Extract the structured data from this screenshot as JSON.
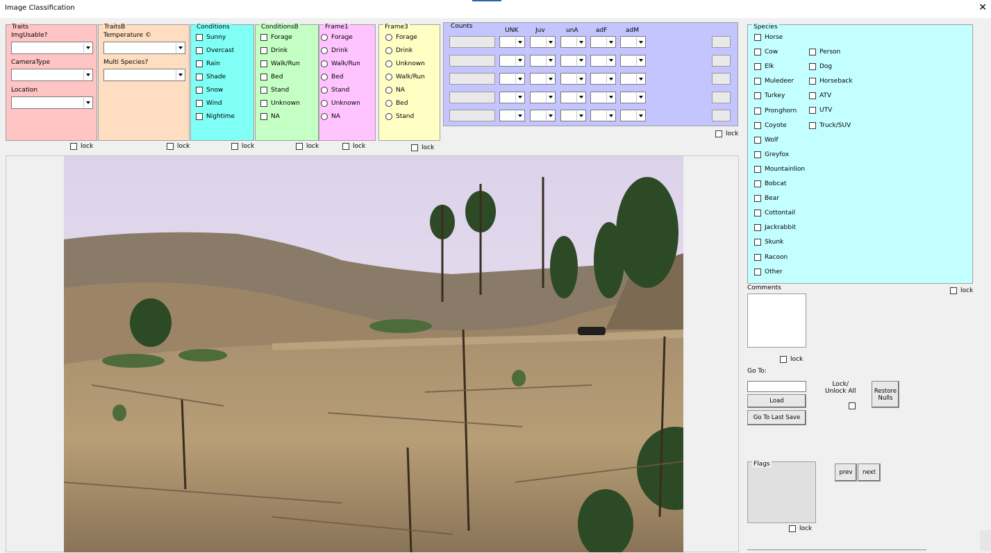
{
  "window": {
    "title": "Image Classification",
    "close_glyph": "✕"
  },
  "lock_label": "lock",
  "traits": {
    "legend": "Traits",
    "img_usable": "ImgUsable?",
    "camera_type": "CameraType",
    "location": "Location"
  },
  "traitsb": {
    "legend": "TraitsB",
    "temperature": "Temperature ©",
    "multi_species": "Multi Species?"
  },
  "conditions": {
    "legend": "Conditions",
    "items": [
      "Sunny",
      "Overcast",
      "Rain",
      "Shade",
      "Snow",
      "Wind",
      "Nightime"
    ]
  },
  "conditionsb": {
    "legend": "ConditionsB",
    "items": [
      "Forage",
      "Drink",
      "Walk/Run",
      "Bed",
      "Stand",
      "Unknown",
      "NA"
    ]
  },
  "frame1": {
    "legend": "Frame1",
    "items": [
      "Forage",
      "Drink",
      "Walk/Run",
      "Bed",
      "Stand",
      "Unknown",
      "NA"
    ]
  },
  "frame3": {
    "legend": "Frame3",
    "items": [
      "Forage",
      "Drink",
      "Unknown",
      "Walk/Run",
      "NA",
      "Bed",
      "Stand"
    ]
  },
  "counts": {
    "legend": "Counts",
    "columns": [
      "UNK",
      "Juv",
      "unA",
      "adF",
      "adM"
    ]
  },
  "species": {
    "legend": "Species",
    "col1": [
      "Horse",
      "Cow",
      "Elk",
      "Muledeer",
      "Turkey",
      "Pronghorn",
      "Coyote",
      "Wolf",
      "Greyfox",
      "Mountainlion",
      "Bobcat",
      "Bear",
      "Cottontail",
      "Jackrabbit",
      "Skunk",
      "Racoon",
      "Other"
    ],
    "col2": [
      "Person",
      "Dog",
      "Horseback",
      "ATV",
      "UTV",
      "Truck/SUV"
    ]
  },
  "comments": {
    "label": "Comments"
  },
  "goto": {
    "label": "Go To:",
    "value": ""
  },
  "buttons": {
    "load": "Load",
    "goto_last_save": "Go To Last Save",
    "lock_unlock_all": "Lock/\nUnlock All",
    "restore_nulls": "Restore\nNulls",
    "prev": "prev",
    "next": "next"
  },
  "flags": {
    "legend": "Flags"
  },
  "colors": {
    "traits": "#ffc4c4",
    "traitsb": "#ffddc0",
    "conditions": "#7ffff6",
    "conditionsb": "#c4ffc4",
    "frame1": "#ffc4ff",
    "frame3": "#ffffc4",
    "counts": "#c4c4ff",
    "species": "#c4ffff"
  }
}
